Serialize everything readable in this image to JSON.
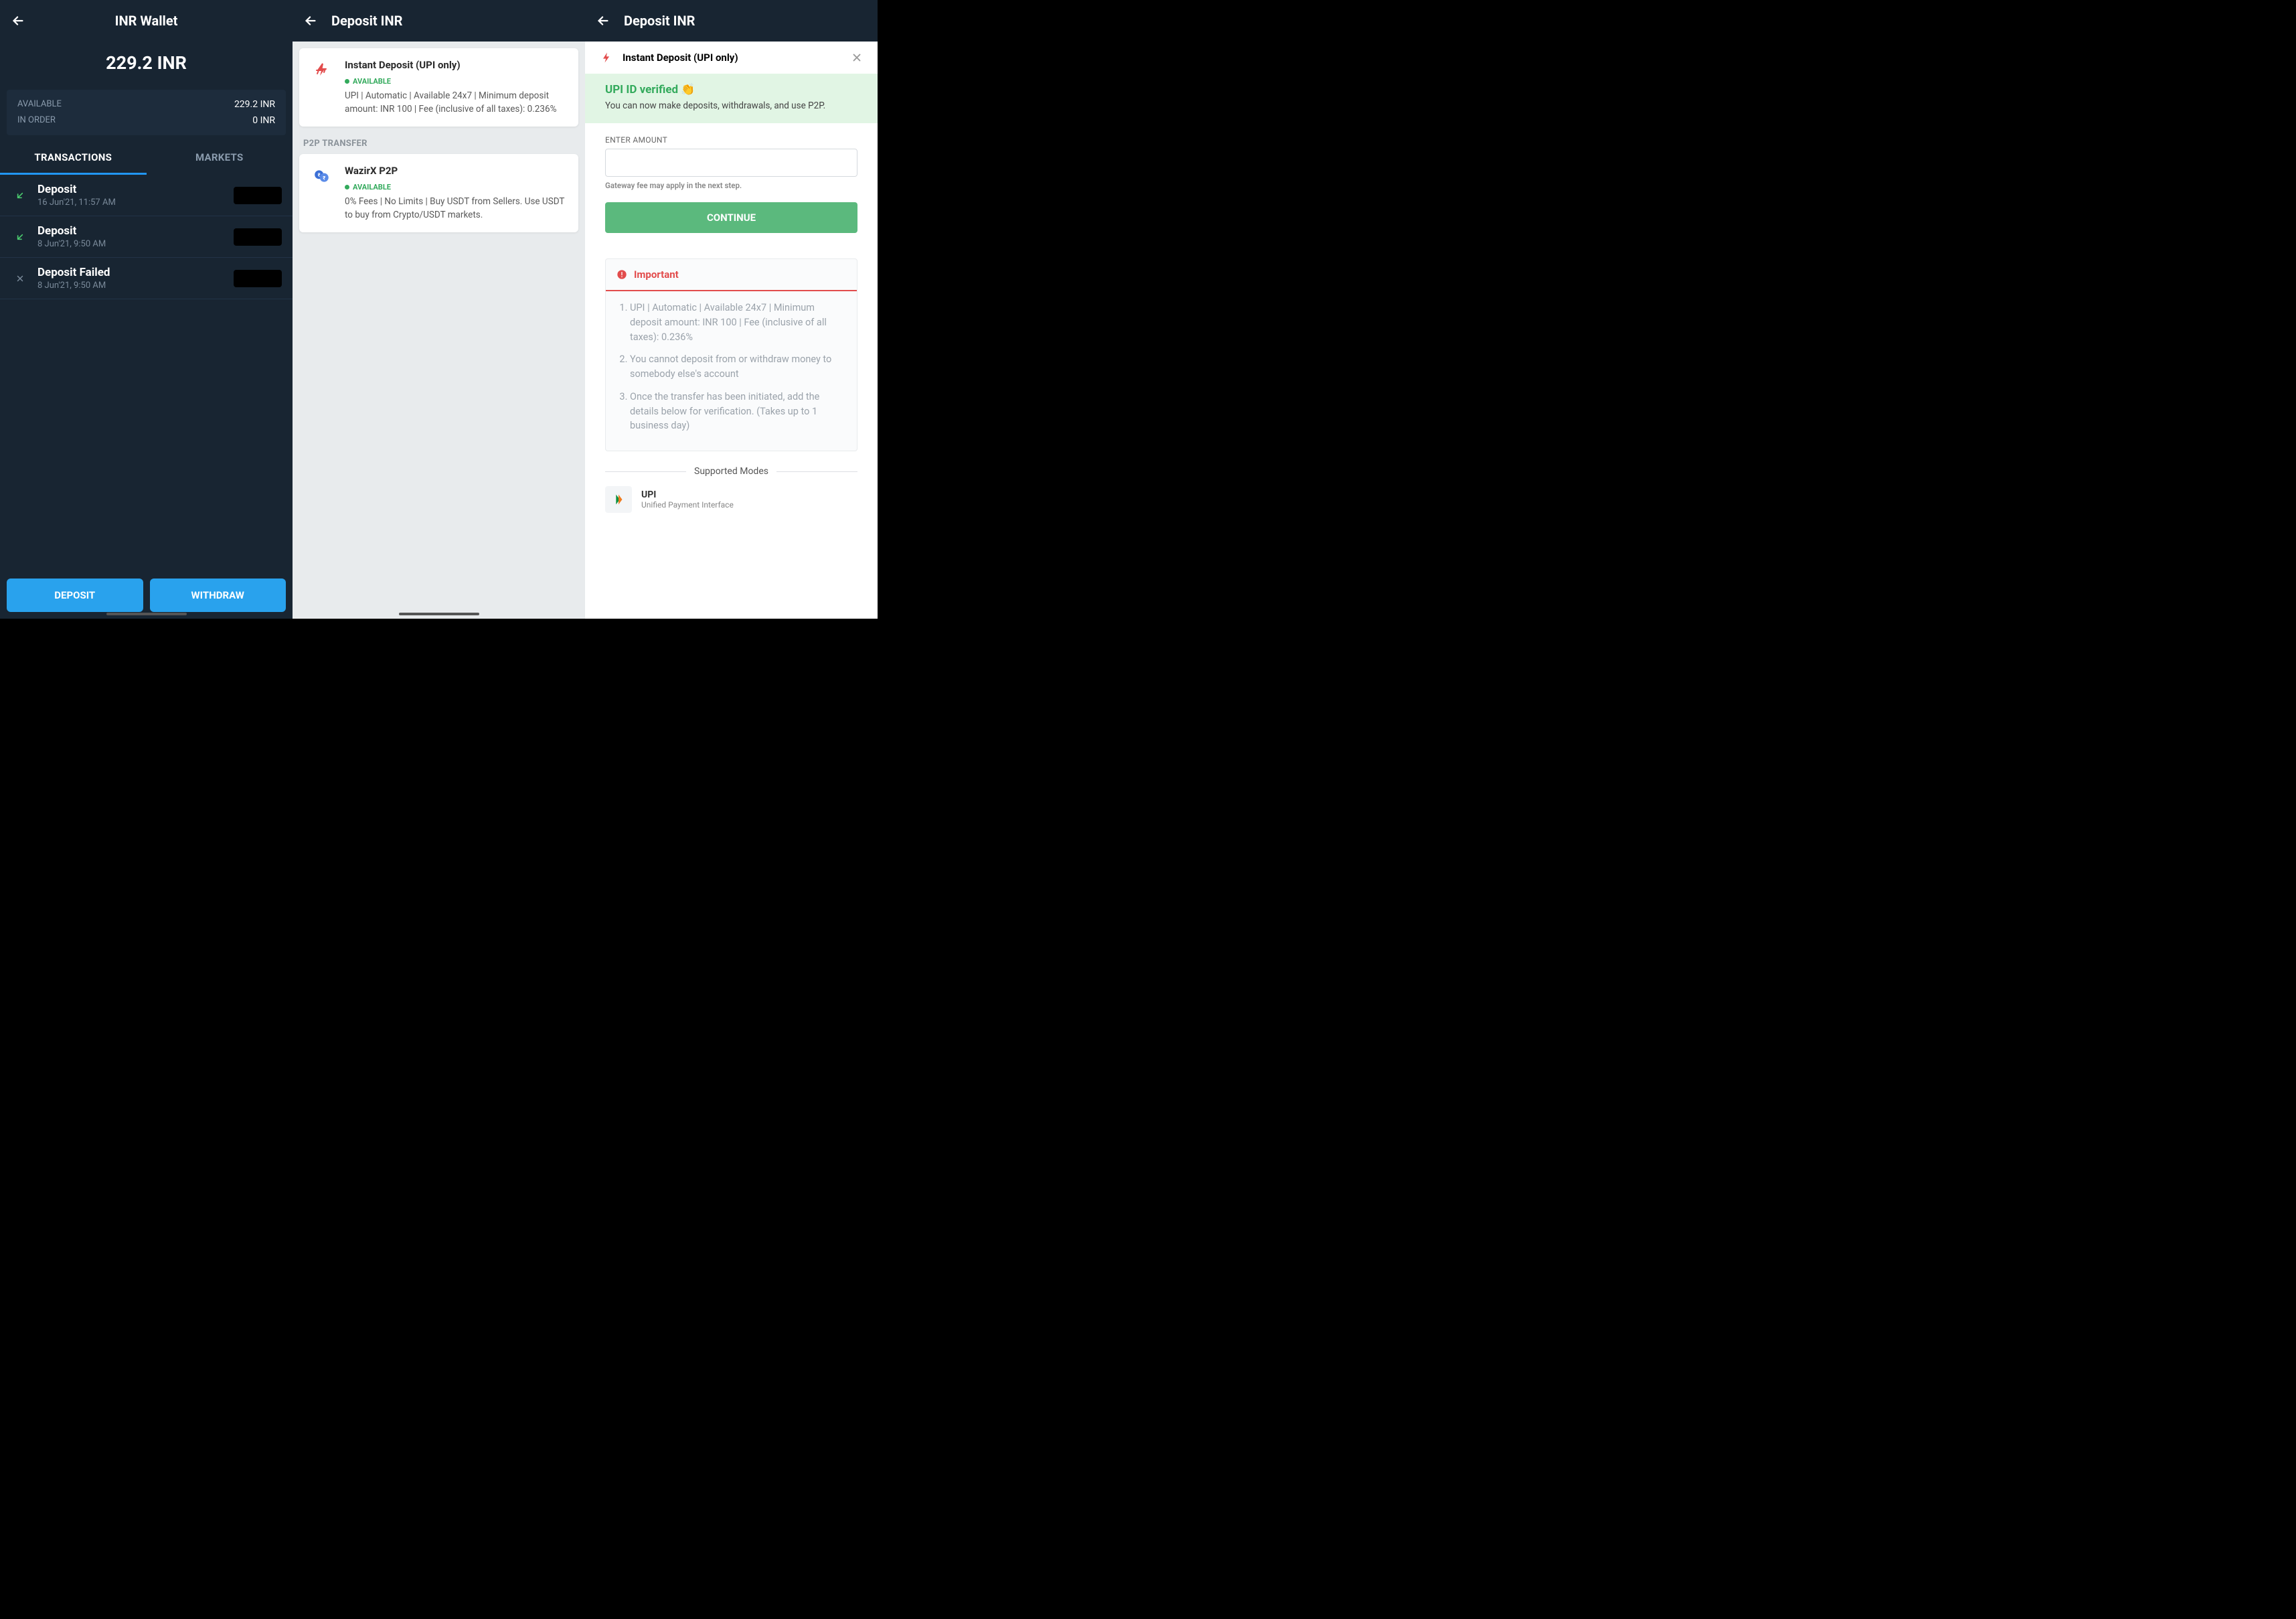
{
  "panel1": {
    "title": "INR Wallet",
    "balance": "229.2 INR",
    "available_label": "AVAILABLE",
    "available_value": "229.2 INR",
    "inorder_label": "IN ORDER",
    "inorder_value": "0 INR",
    "tabs": {
      "transactions": "TRANSACTIONS",
      "markets": "MARKETS"
    },
    "transactions": [
      {
        "title": "Deposit",
        "date": "16 Jun'21, 11:57 AM",
        "status": "success"
      },
      {
        "title": "Deposit",
        "date": "8 Jun'21, 9:50 AM",
        "status": "success"
      },
      {
        "title": "Deposit Failed",
        "date": "8 Jun'21, 9:50 AM",
        "status": "failed"
      }
    ],
    "deposit_btn": "DEPOSIT",
    "withdraw_btn": "WITHDRAW"
  },
  "panel2": {
    "title": "Deposit INR",
    "instant": {
      "title": "Instant Deposit (UPI only)",
      "status": "AVAILABLE",
      "desc": "UPI | Automatic | Available 24x7 | Minimum deposit amount: INR 100 | Fee (inclusive of all taxes): 0.236%"
    },
    "p2p_label": "P2P TRANSFER",
    "p2p": {
      "title": "WazirX P2P",
      "status": "AVAILABLE",
      "desc": "0% Fees | No Limits | Buy USDT from Sellers. Use USDT to buy from Crypto/USDT markets."
    }
  },
  "panel3": {
    "title": "Deposit INR",
    "sheet_title": "Instant Deposit (UPI only)",
    "verified_title": "UPI ID verified 👏",
    "verified_desc": "You can now make deposits, withdrawals, and use P2P.",
    "amount_label": "ENTER AMOUNT",
    "amount_hint": "Gateway fee may apply in the next step.",
    "continue": "CONTINUE",
    "important_title": "Important",
    "important_items": [
      "UPI | Automatic | Available 24x7 | Minimum deposit amount: INR 100 | Fee (inclusive of all taxes): 0.236%",
      "You cannot deposit from or withdraw money to somebody else's account",
      "Once the transfer has been initiated, add the details below for verification. (Takes up to 1 business day)"
    ],
    "supported_label": "Supported Modes",
    "mode": {
      "title": "UPI",
      "sub": "Unified Payment Interface"
    }
  }
}
